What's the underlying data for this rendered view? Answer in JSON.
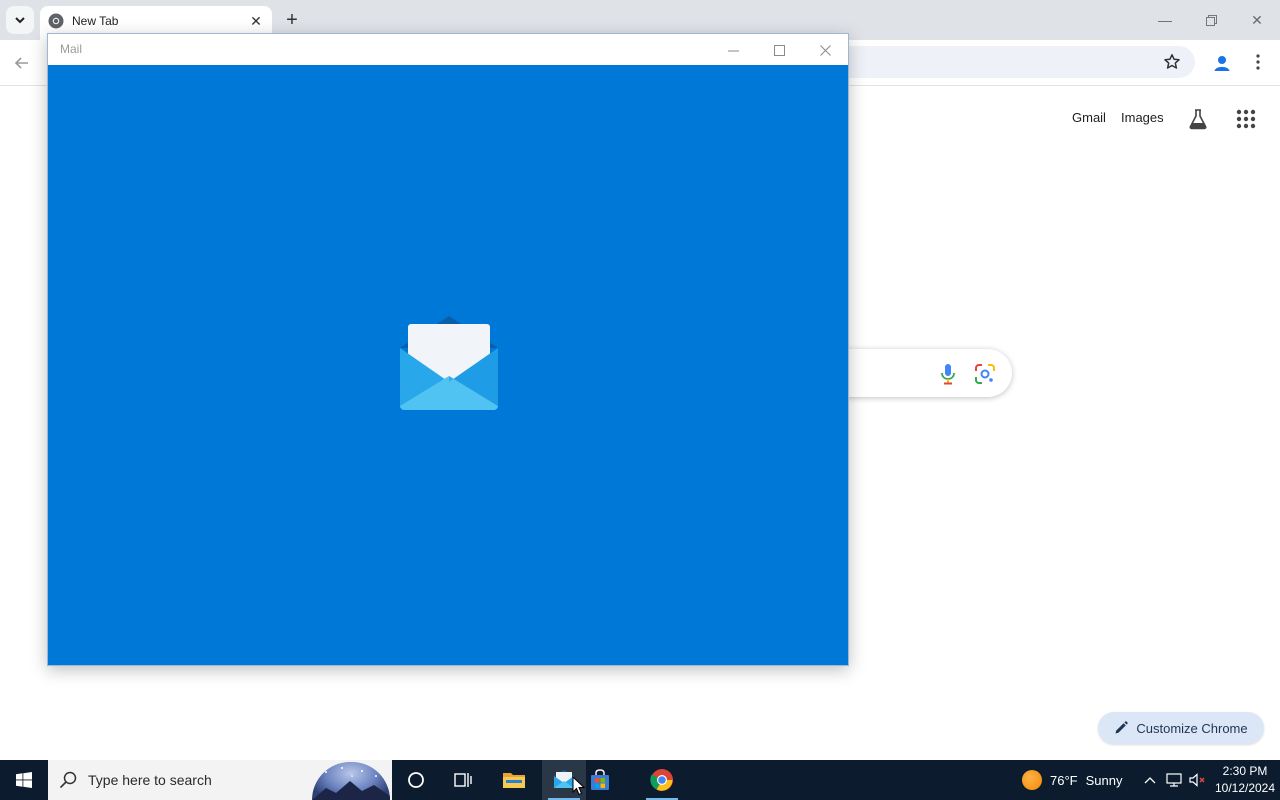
{
  "browser": {
    "tab": {
      "title": "New Tab"
    },
    "ntp": {
      "gmail_label": "Gmail",
      "images_label": "Images",
      "customize_label": "Customize Chrome"
    }
  },
  "mail_window": {
    "title": "Mail",
    "icons": {
      "minimize": "minimize-icon",
      "maximize": "maximize-icon",
      "close": "close-icon",
      "splash": "mail-envelope-icon"
    },
    "background_color": "#0078d7"
  },
  "taskbar": {
    "search_placeholder": "Type here to search",
    "weather": {
      "temp": "76°F",
      "condition": "Sunny"
    },
    "clock": {
      "time": "2:30 PM",
      "date": "10/12/2024"
    },
    "apps": [
      "cortana",
      "task-view",
      "file-explorer",
      "mail",
      "microsoft-store",
      "chrome"
    ]
  }
}
